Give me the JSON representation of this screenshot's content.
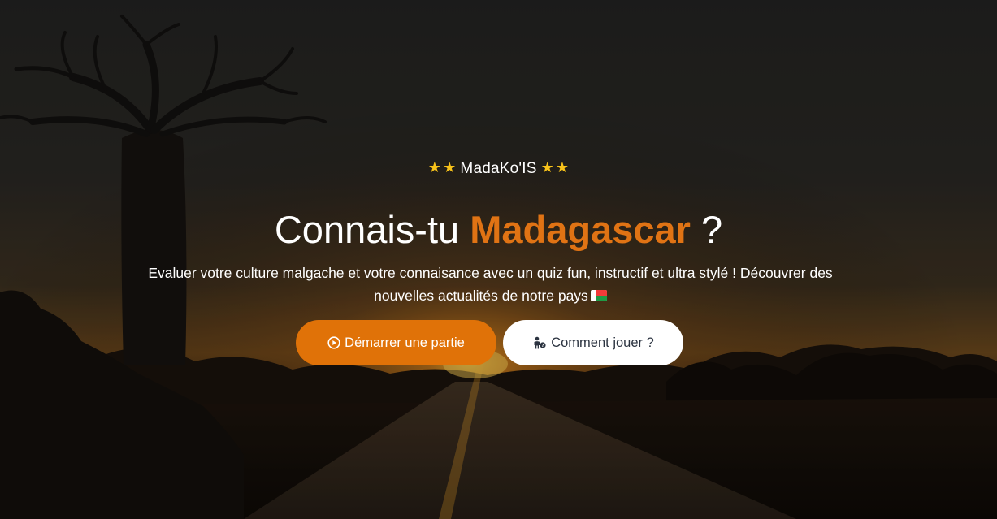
{
  "brand": {
    "name": "MadaKo'IS",
    "stars_left": "⭐ ⭐",
    "stars_right": "⭐ ⭐"
  },
  "headline": {
    "prefix": "Connais-tu ",
    "accent": "Madagascar",
    "suffix": " ?"
  },
  "subtitle": {
    "text": "Evaluer votre culture malgache et votre connaisance avec un quiz fun, instructif et ultra stylé ! Découvrer des nouvelles actualités de notre pays"
  },
  "buttons": {
    "start_label": "Démarrer une partie",
    "start_icon": "play-circle-icon",
    "how_label": "Comment jouer ?",
    "how_icon": "person-question-icon"
  },
  "colors": {
    "accent": "#e07314",
    "star": "#f7c21a",
    "button_primary": "#e07208",
    "button_secondary": "#ffffff",
    "secondary_text": "#2b3340"
  }
}
